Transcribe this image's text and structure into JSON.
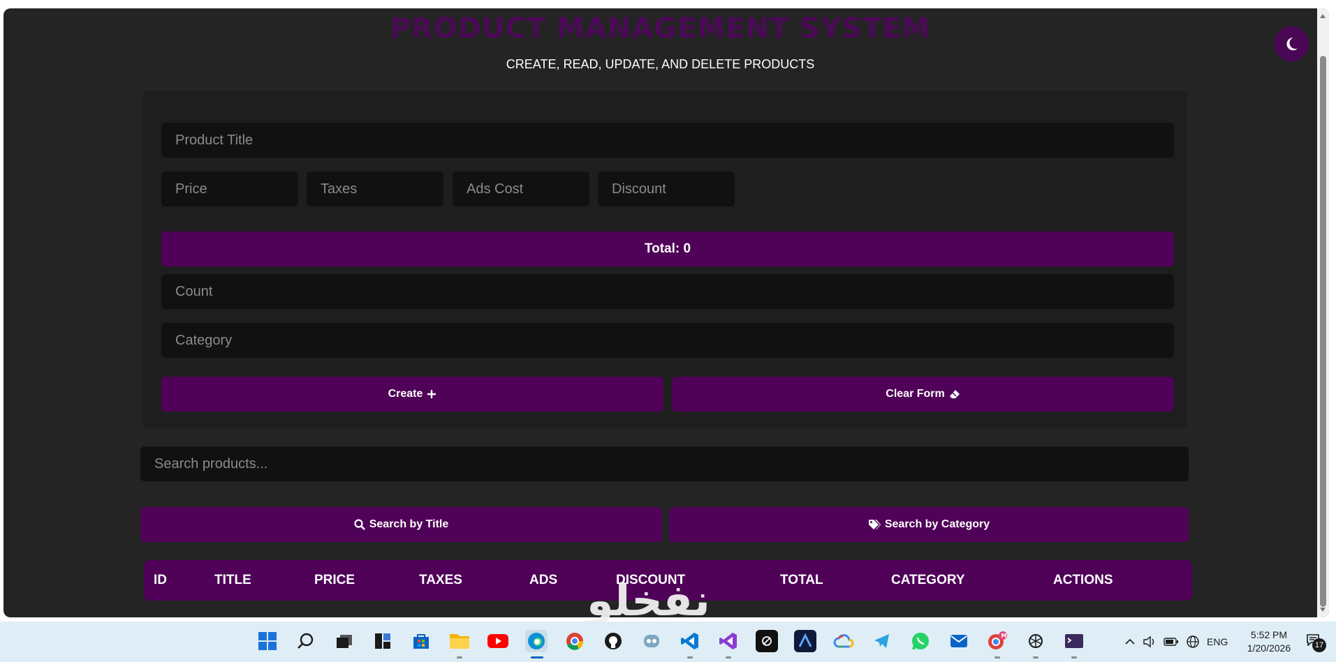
{
  "app": {
    "title": "PRODUCT MANAGEMENT SYSTEM",
    "subtitle": "CREATE, READ, UPDATE, AND DELETE PRODUCTS",
    "accent_color": "#4f0258"
  },
  "theme_toggle": {
    "icon": "moon-icon"
  },
  "form": {
    "title_placeholder": "Product Title",
    "price_placeholder": "Price",
    "taxes_placeholder": "Taxes",
    "ads_placeholder": "Ads Cost",
    "discount_placeholder": "Discount",
    "total_label": "Total: 0",
    "count_placeholder": "Count",
    "category_placeholder": "Category",
    "create_label": "Create",
    "create_icon": "plus-icon",
    "clear_label": "Clear Form",
    "clear_icon": "eraser-icon"
  },
  "search": {
    "placeholder": "Search products...",
    "by_title_label": "Search by Title",
    "by_title_icon": "search-icon",
    "by_category_label": "Search by Category",
    "by_category_icon": "tags-icon"
  },
  "table": {
    "columns": [
      "ID",
      "TITLE",
      "PRICE",
      "TAXES",
      "ADS",
      "DISCOUNT",
      "TOTAL",
      "CATEGORY",
      "ACTIONS"
    ]
  },
  "watermark": {
    "text": "نفخلو"
  },
  "taskbar": {
    "apps": [
      "windows-start",
      "search",
      "task-view",
      "widgets",
      "microsoft-store",
      "file-explorer",
      "youtube",
      "edge",
      "chrome",
      "github-desktop",
      "copilot",
      "vs-code",
      "visual-studio",
      "cursor",
      "arc",
      "google-cloud",
      "telegram",
      "whatsapp",
      "mail",
      "chrome-profile",
      "chatgpt",
      "terminal"
    ],
    "language": "ENG",
    "time": "5:52 PM",
    "date": "1/20/2026",
    "notification_count": "17"
  }
}
